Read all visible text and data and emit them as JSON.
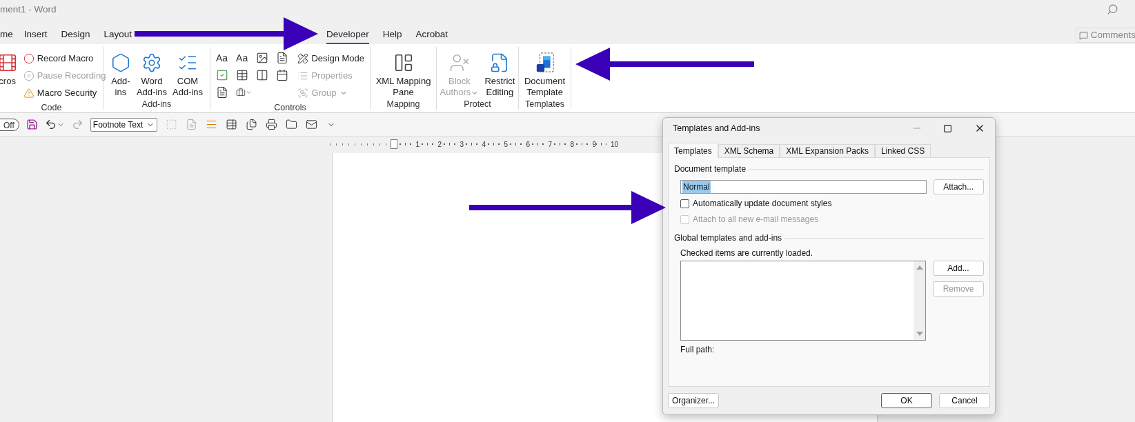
{
  "window": {
    "title": "ment1  -  Word"
  },
  "ribbon_tabs": [
    {
      "label": "me",
      "selected": false
    },
    {
      "label": "Insert",
      "selected": false
    },
    {
      "label": "Design",
      "selected": false
    },
    {
      "label": "Layout",
      "selected": false
    },
    {
      "label": "Developer",
      "selected": true
    },
    {
      "label": "Help",
      "selected": false
    },
    {
      "label": "Acrobat",
      "selected": false
    }
  ],
  "comments_button": {
    "label": "Comments"
  },
  "ribbon_groups": [
    {
      "label": "Code",
      "items": [
        {
          "kind": "large",
          "label": "cros",
          "disabled": false,
          "menu": false
        },
        {
          "kind": "small",
          "label": "Record Macro",
          "disabled": false,
          "menu": false
        },
        {
          "kind": "small",
          "label": "Pause Recording",
          "disabled": true,
          "menu": false
        },
        {
          "kind": "small",
          "label": "Macro Security",
          "disabled": false,
          "menu": false
        }
      ]
    },
    {
      "label": "Add-ins",
      "items": [
        {
          "kind": "large",
          "label": "Add-\nins",
          "disabled": false,
          "menu": false
        },
        {
          "kind": "large",
          "label": "Word\nAdd-ins",
          "disabled": false,
          "menu": false
        },
        {
          "kind": "large",
          "label": "COM\nAdd-ins",
          "disabled": false,
          "menu": false
        }
      ]
    },
    {
      "label": "Controls",
      "items": [
        {
          "kind": "glyph",
          "label": "Aa",
          "disabled": false,
          "menu": false
        },
        {
          "kind": "glyph",
          "label": "Aa",
          "disabled": false,
          "menu": false
        },
        {
          "kind": "icon",
          "disabled": false,
          "menu": false
        },
        {
          "kind": "icon",
          "disabled": false,
          "menu": false
        },
        {
          "kind": "icon",
          "disabled": false,
          "menu": false
        },
        {
          "kind": "icon",
          "disabled": false,
          "menu": false
        },
        {
          "kind": "icon",
          "disabled": false,
          "menu": false
        },
        {
          "kind": "icon",
          "disabled": false,
          "menu": false
        },
        {
          "kind": "icon",
          "disabled": false,
          "menu": false
        },
        {
          "kind": "icon",
          "disabled": false,
          "menu": true
        },
        {
          "kind": "small",
          "label": "Design Mode",
          "disabled": false,
          "menu": false
        },
        {
          "kind": "small",
          "label": "Properties",
          "disabled": true,
          "menu": false
        },
        {
          "kind": "small",
          "label": "Group",
          "disabled": true,
          "menu": true
        }
      ]
    },
    {
      "label": "Mapping",
      "items": [
        {
          "kind": "large",
          "label": "XML Mapping\nPane",
          "disabled": false,
          "menu": false
        }
      ]
    },
    {
      "label": "Protect",
      "items": [
        {
          "kind": "large",
          "label": "Block\nAuthors",
          "disabled": true,
          "menu": true
        },
        {
          "kind": "large",
          "label": "Restrict\nEditing",
          "disabled": false,
          "menu": false
        }
      ]
    },
    {
      "label": "Templates",
      "items": [
        {
          "kind": "large",
          "label": "Document\nTemplate",
          "disabled": false,
          "menu": false
        }
      ]
    }
  ],
  "toolbar": {
    "autosave": {
      "label": "Off",
      "on": false
    },
    "style_box": {
      "value": "Footnote Text"
    }
  },
  "ruler": {
    "numbers": [
      "1",
      "2",
      "3",
      "4",
      "5",
      "6",
      "7",
      "8",
      "9",
      "10"
    ]
  },
  "dialog": {
    "title": "Templates and Add-ins",
    "tabs": [
      {
        "label": "Templates",
        "selected": true
      },
      {
        "label": "XML Schema",
        "selected": false
      },
      {
        "label": "XML Expansion Packs",
        "selected": false
      },
      {
        "label": "Linked CSS",
        "selected": false
      }
    ],
    "document_template": {
      "heading": "Document template",
      "field": {
        "value": "Normal"
      },
      "attach_button": "Attach...",
      "options": [
        {
          "label": "Automatically update document styles",
          "checked": false,
          "disabled": false
        },
        {
          "label": "Attach to all new e-mail messages",
          "checked": false,
          "disabled": true
        }
      ]
    },
    "global": {
      "heading": "Global templates and add-ins",
      "note": "Checked items are currently loaded.",
      "buttons": [
        {
          "label": "Add...",
          "disabled": false
        },
        {
          "label": "Remove",
          "disabled": true
        }
      ],
      "full_path_label": "Full path:"
    },
    "footer_buttons": [
      {
        "label": "Organizer...",
        "default": false
      },
      {
        "label": "OK",
        "default": true
      },
      {
        "label": "Cancel",
        "default": false
      }
    ]
  }
}
